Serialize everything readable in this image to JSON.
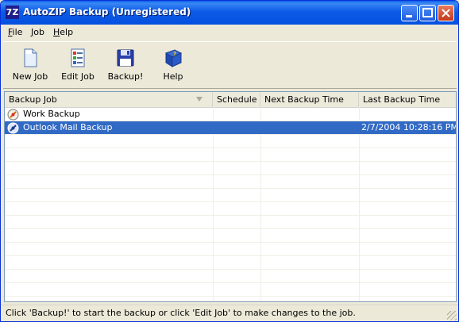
{
  "window": {
    "title": "AutoZIP Backup (Unregistered)",
    "app_icon_text": "7Z"
  },
  "menu": [
    {
      "label": "File",
      "accel": "F"
    },
    {
      "label": "Job",
      "accel": "J"
    },
    {
      "label": "Help",
      "accel": "H"
    }
  ],
  "toolbar": {
    "new_job": "New Job",
    "edit_job": "Edit Job",
    "backup": "Backup!",
    "help": "Help"
  },
  "list": {
    "columns": [
      "Backup Job",
      "Schedule",
      "Next Backup Time",
      "Last Backup Time"
    ],
    "rows": [
      {
        "name": "Work Backup",
        "schedule": "",
        "next": "",
        "last": ""
      },
      {
        "name": "Outlook Mail Backup",
        "schedule": "",
        "next": "",
        "last": "2/7/2004 10:28:16 PM"
      }
    ]
  },
  "status": {
    "text": "Click 'Backup!' to start the backup or click 'Edit Job' to make changes to the job."
  },
  "colors": {
    "titlebar": "#0450e0",
    "selection": "#316ac5",
    "face": "#ece9d8"
  }
}
